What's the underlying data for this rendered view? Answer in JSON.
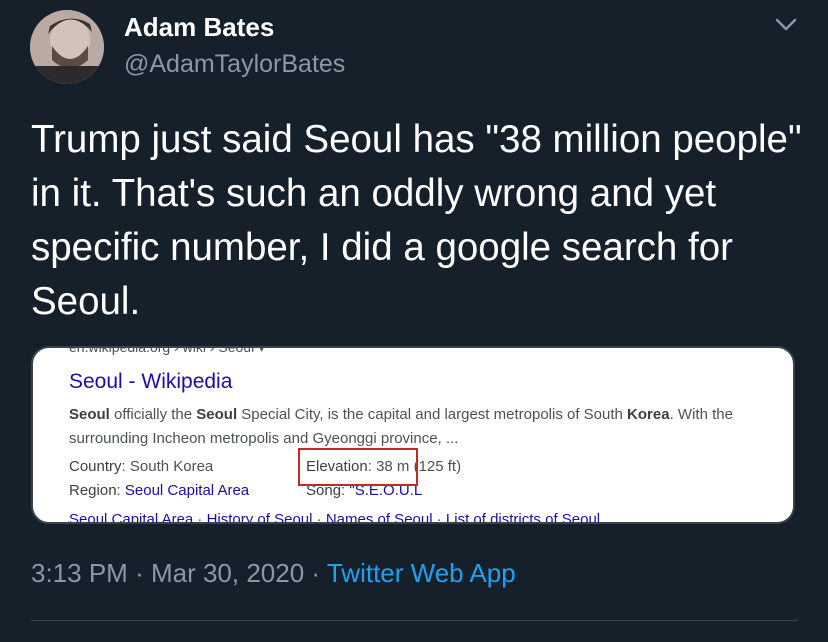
{
  "author": {
    "name": "Adam Bates",
    "handle": "@AdamTaylorBates"
  },
  "tweet": {
    "text": "Trump just said Seoul has \"38 million people\" in it. That's such an oddly wrong and yet specific number, I did a google search for Seoul.",
    "time": "3:13 PM",
    "date": "Mar 30, 2020",
    "separator": "·",
    "source_app": "Twitter Web App"
  },
  "search_card": {
    "breadcrumb": "en.wikipedia.org › wiki › Seoul ▾",
    "title": "Seoul - Wikipedia",
    "snippet": [
      {
        "t": "Seoul",
        "b": true
      },
      {
        "t": " officially the ",
        "b": false
      },
      {
        "t": "Seoul",
        "b": true
      },
      {
        "t": " Special City, is the capital and largest metropolis of South ",
        "b": false
      },
      {
        "t": "Korea",
        "b": true
      },
      {
        "t": ". With the surrounding Incheon metropolis and Gyeonggi province, ...",
        "b": false
      }
    ],
    "facts": {
      "country_label": "Country",
      "country_value": "South Korea",
      "elevation_label": "Elevation",
      "elevation_value": "38 m (125 ft)",
      "region_label": "Region",
      "region_value": "Seoul Capital Area",
      "song_label": "Song",
      "song_value": "\"S.E.O.U.L"
    },
    "related_links": [
      "Seoul Capital Area",
      "History of Seoul",
      "Names of Seoul",
      "List of districts of Seoul"
    ],
    "highlight_color": "#c62828"
  },
  "icons": {
    "caret": "chevron-down-icon",
    "avatar": "avatar"
  },
  "colors": {
    "background": "#15202b",
    "text": "#ffffff",
    "muted": "#8899a6",
    "link": "#1da1f2"
  }
}
